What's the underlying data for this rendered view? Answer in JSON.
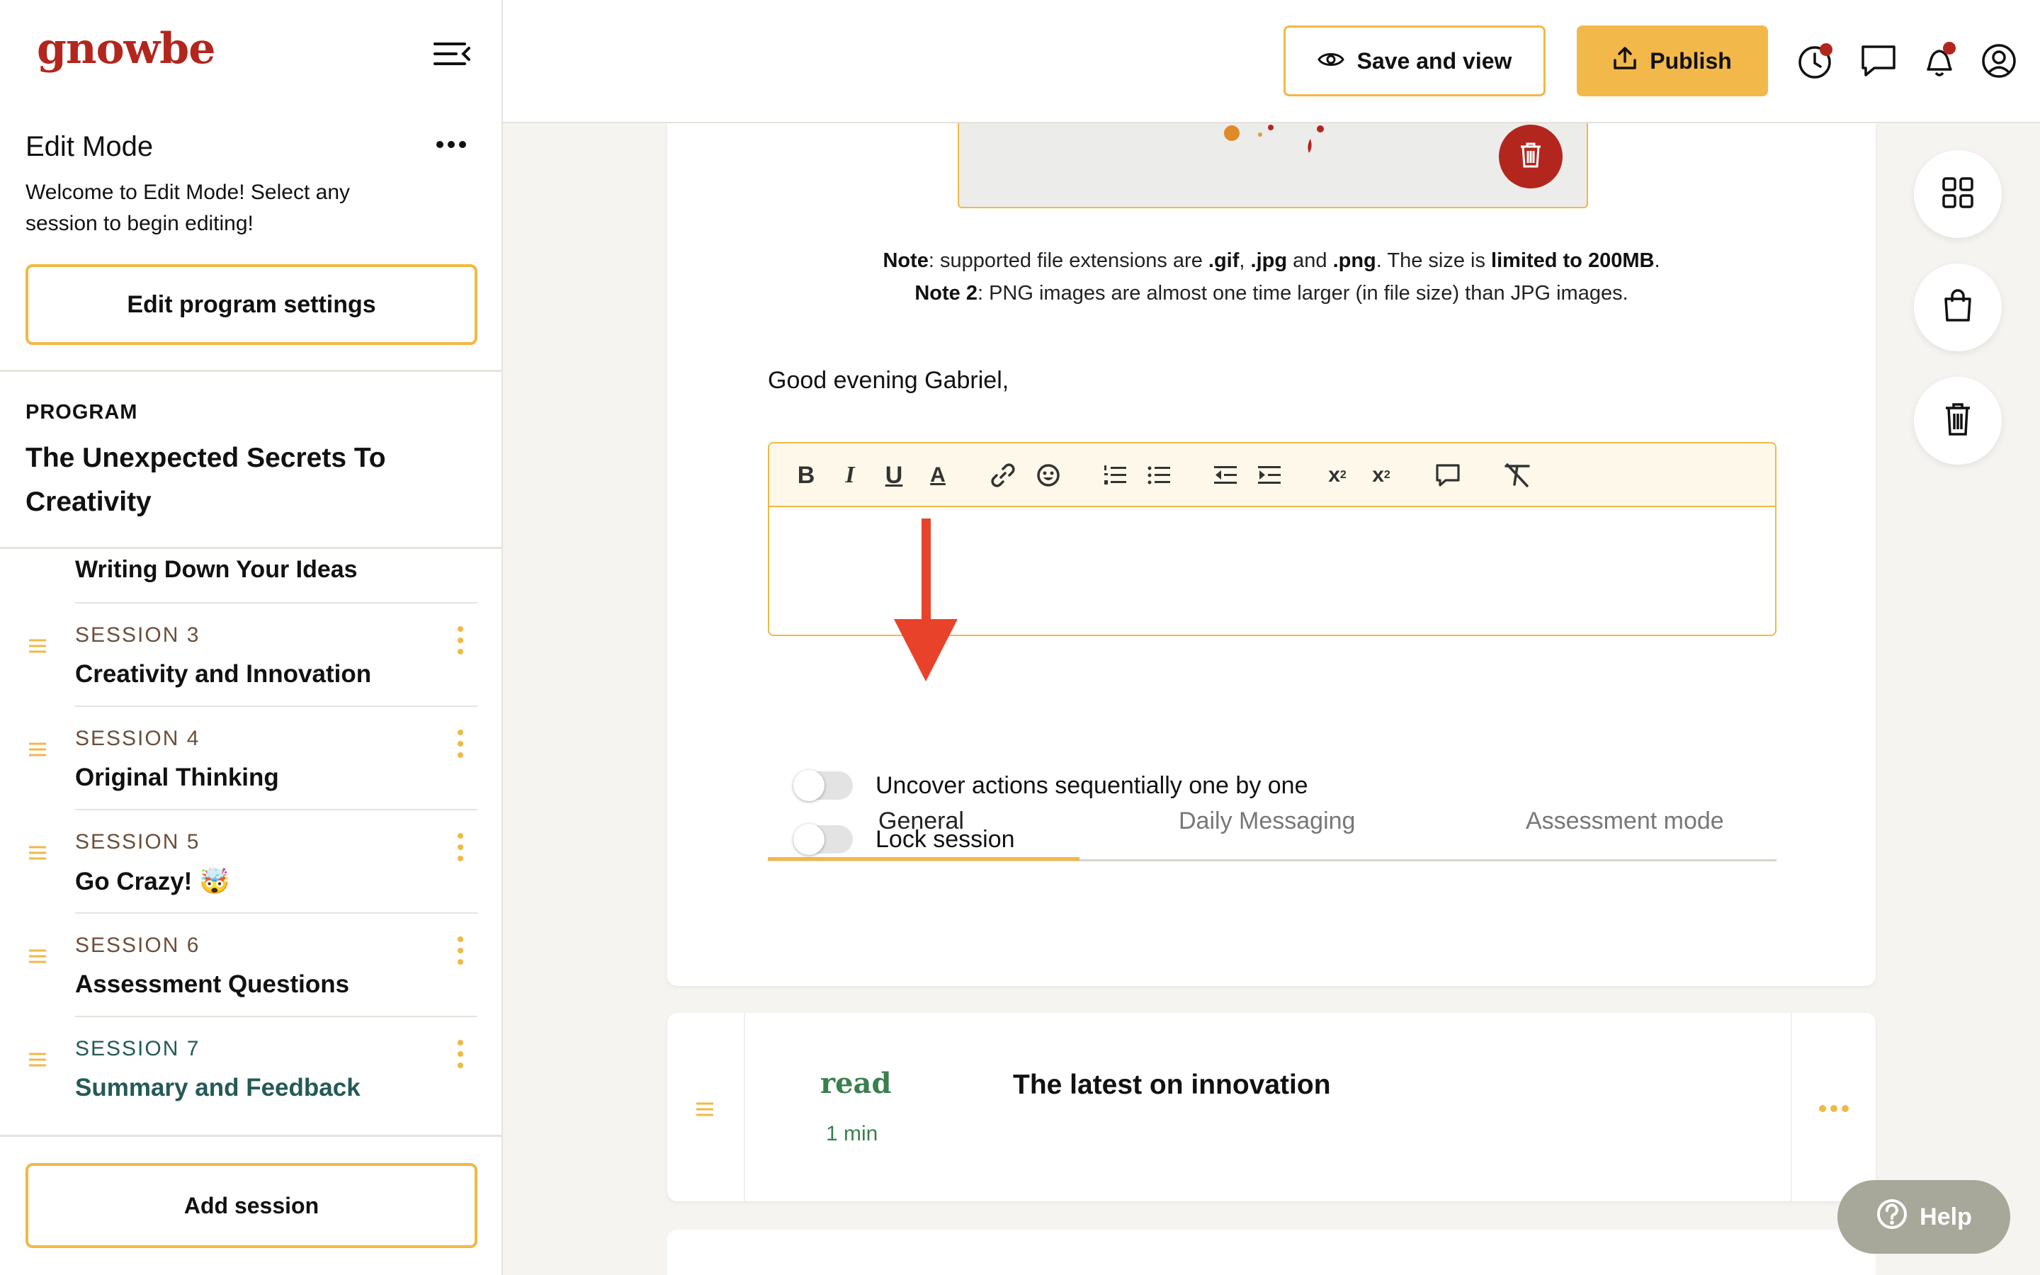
{
  "sidebar": {
    "logo": "gnowbe",
    "mode_title": "Edit Mode",
    "welcome": "Welcome to Edit Mode! Select any session to begin editing!",
    "edit_settings_label": "Edit program settings",
    "program_label": "PROGRAM",
    "program_title": "The Unexpected Secrets To Creativity",
    "first_session_name": "Writing Down Your Ideas",
    "sessions": [
      {
        "number": "SESSION 3",
        "name": "Creativity and Innovation"
      },
      {
        "number": "SESSION 4",
        "name": "Original Thinking"
      },
      {
        "number": "SESSION 5",
        "name": "Go Crazy! 🤯"
      },
      {
        "number": "SESSION 6",
        "name": "Assessment Questions"
      },
      {
        "number": "SESSION 7",
        "name": "Summary and Feedback"
      }
    ],
    "add_session_label": "Add session"
  },
  "topbar": {
    "save_view_label": "Save and view",
    "publish_label": "Publish"
  },
  "main": {
    "note1_label": "Note",
    "note1_text1": ": supported file extensions are ",
    "ext_gif": ".gif",
    "comma": ", ",
    "ext_jpg": ".jpg",
    "and_text": " and ",
    "ext_png": ".png",
    "note1_text2": ". The size is ",
    "size_limit": "limited to 200MB",
    "period": ".",
    "note2_label": "Note 2",
    "note2_text": ": PNG images are almost one time larger (in file size) than JPG images.",
    "greeting": "Good evening Gabriel,",
    "toolbar_glyphs": {
      "bold": "B",
      "italic": "I",
      "underline": "U",
      "font_color": "A",
      "subscript_base": "x",
      "subscript_mark": "2",
      "superscript_base": "x",
      "superscript_mark": "2"
    },
    "tabs": [
      "General",
      "Daily Messaging",
      "Assessment mode"
    ],
    "toggles": [
      {
        "label": "Uncover actions sequentially one by one",
        "on": false
      },
      {
        "label": "Lock session",
        "on": false
      }
    ]
  },
  "action_card": {
    "type_label": "read",
    "duration": "1 min",
    "title": "The latest on innovation"
  },
  "help_label": "Help",
  "colors": {
    "accent": "#f2b844",
    "brand": "#b3261e",
    "teal": "#245a56",
    "read_green": "#3a7f4c",
    "arrow": "#e8432a"
  }
}
